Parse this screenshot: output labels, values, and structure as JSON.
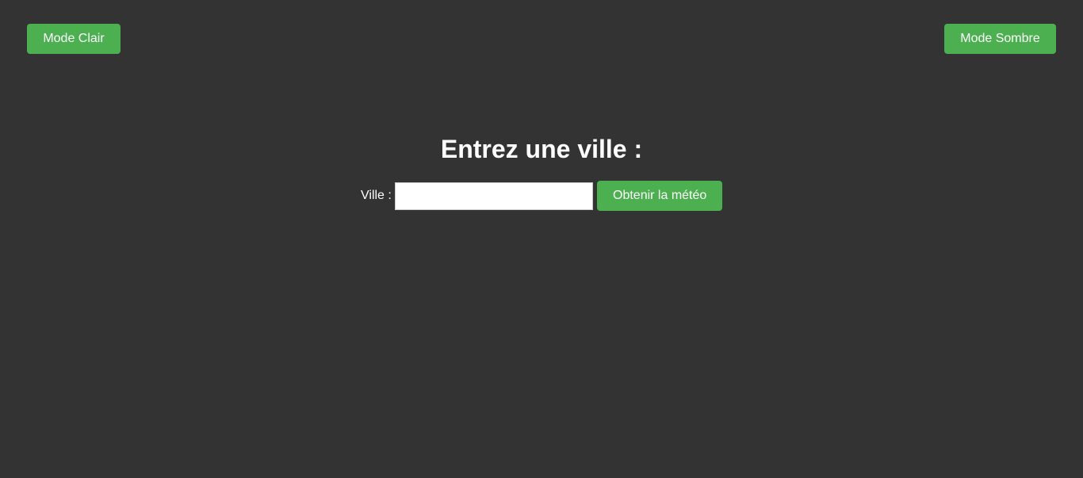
{
  "header": {
    "light_mode_label": "Mode Clair",
    "dark_mode_label": "Mode Sombre"
  },
  "main": {
    "title": "Entrez une ville :",
    "city_label": "Ville :",
    "city_value": "",
    "city_placeholder": "",
    "submit_label": "Obtenir la météo"
  },
  "colors": {
    "background": "#333333",
    "accent": "#4caf50",
    "text": "#ffffff"
  }
}
